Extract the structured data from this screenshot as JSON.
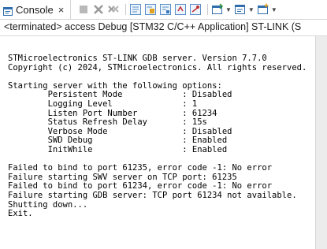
{
  "tab": {
    "label": "Console",
    "close_glyph": "×",
    "icon": "console-icon"
  },
  "toolbar": {
    "buttons": [
      "terminate-icon",
      "remove-launch-icon",
      "remove-all-terminated-icon",
      "copy-icon",
      "paste-icon",
      "word-wrap-icon",
      "scroll-lock-icon",
      "pin-icon",
      "open-console-icon",
      "display-selected-console-icon",
      "new-console-icon"
    ]
  },
  "subtitle": "<terminated> access Debug [STM32 C/C++ Application] ST-LINK (S",
  "console": {
    "lines": [
      "STMicroelectronics ST-LINK GDB server. Version 7.7.0",
      "Copyright (c) 2024, STMicroelectronics. All rights reserved.",
      "",
      "Starting server with the following options:",
      "        Persistent Mode            : Disabled",
      "        Logging Level              : 1",
      "        Listen Port Number         : 61234",
      "        Status Refresh Delay       : 15s",
      "        Verbose Mode               : Disabled",
      "        SWD Debug                  : Enabled",
      "        InitWhile                  : Enabled",
      "",
      "Failed to bind to port 61235, error code -1: No error",
      "Failure starting SWV server on TCP port: 61235",
      "Failed to bind to port 61234, error code -1: No error",
      "Failure starting GDB server: TCP port 61234 not available.",
      "Shutting down...",
      "Exit."
    ]
  },
  "colors": {
    "accent": "#2f6dad",
    "toolbar_gray": "#8a8a8a",
    "text": "#000000"
  }
}
